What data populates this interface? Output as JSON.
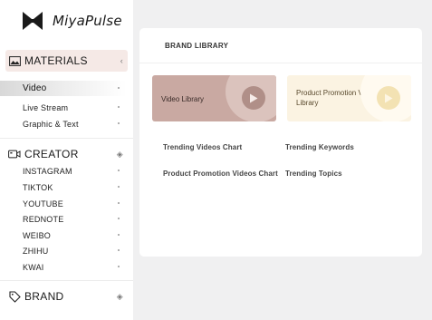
{
  "logo": {
    "text": "MiyaPulse",
    "icon": "bowtie-logo-icon"
  },
  "sidebar": {
    "materials": {
      "label": "MATERIALS",
      "icon": "image-icon",
      "trail": "‹",
      "items": [
        {
          "label": "Video",
          "selected": true
        },
        {
          "label": "Live Stream"
        },
        {
          "label": "Graphic & Text"
        }
      ]
    },
    "creator": {
      "label": "CREATOR",
      "icon": "video-camera-icon",
      "trail": "◈",
      "items": [
        {
          "label": "INSTAGRAM"
        },
        {
          "label": "TIKTOK"
        },
        {
          "label": "YOUTUBE"
        },
        {
          "label": "REDNOTE"
        },
        {
          "label": "WEIBO"
        },
        {
          "label": "ZHIHU"
        },
        {
          "label": "KWAI"
        }
      ]
    },
    "brand": {
      "label": "BRAND",
      "icon": "tag-icon",
      "trail": "◈"
    }
  },
  "main": {
    "title": "BRAND LIBRARY",
    "tiles": [
      {
        "label": "Video Library",
        "icon": "play-icon"
      },
      {
        "label": "Product Promotion Video Library",
        "icon": "play-icon"
      }
    ],
    "links": [
      "Trending Videos Chart",
      "Trending Keywords",
      "Product Promotion Videos Chart",
      "Trending Topics"
    ]
  },
  "colors": {
    "video_tile": "#c9a9a2",
    "promo_tile": "#fbf3e2",
    "active_section": "#f5e9e6"
  }
}
